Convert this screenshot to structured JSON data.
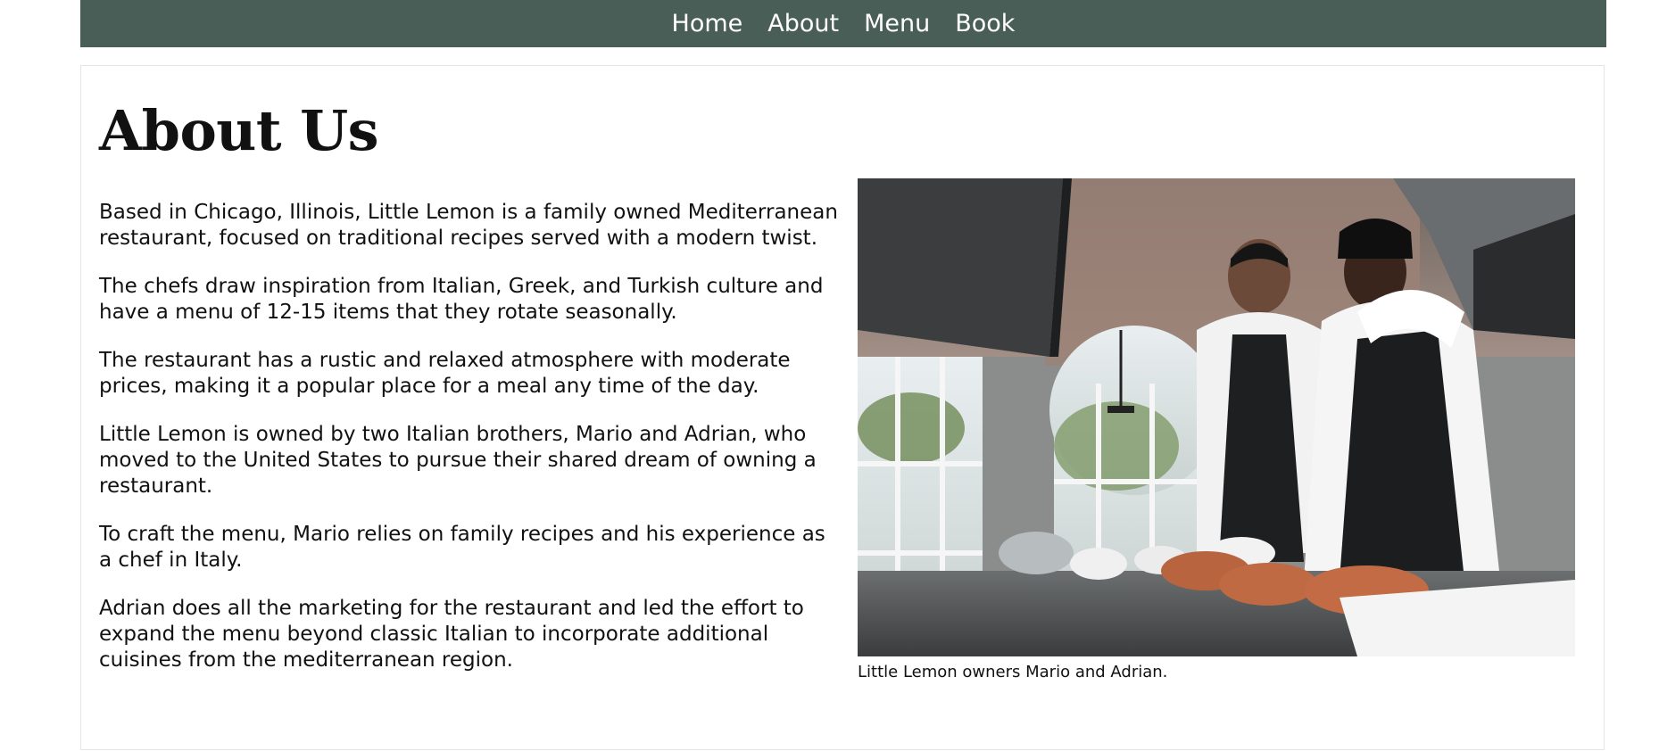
{
  "nav": {
    "items": [
      {
        "label": "Home"
      },
      {
        "label": "About"
      },
      {
        "label": "Menu"
      },
      {
        "label": "Book"
      }
    ]
  },
  "about": {
    "title": "About Us",
    "paragraphs": [
      "Based in Chicago, Illinois, Little Lemon is a family owned Mediterranean restaurant, focused on traditional recipes served with a modern twist.",
      "The chefs draw inspiration from Italian, Greek, and Turkish culture and have a menu of 12-15 items that they rotate seasonally.",
      "The restaurant has a rustic and relaxed atmosphere with moderate prices, making it a popular place for a meal any time of the day.",
      "Little Lemon is owned by two Italian brothers, Mario and Adrian, who moved to the United States to pursue their shared dream of owning a restaurant.",
      "To craft the menu, Mario relies on family recipes and his experience as a chef in Italy.",
      "Adrian does all the marketing for the restaurant and led the effort to expand the menu beyond classic Italian to incorporate additional cuisines from the mediterranean region."
    ],
    "image": {
      "caption": "Little Lemon owners Mario and Adrian."
    }
  },
  "colors": {
    "nav_background": "#495e57",
    "nav_text": "#ffffff",
    "body_text": "#111111"
  }
}
